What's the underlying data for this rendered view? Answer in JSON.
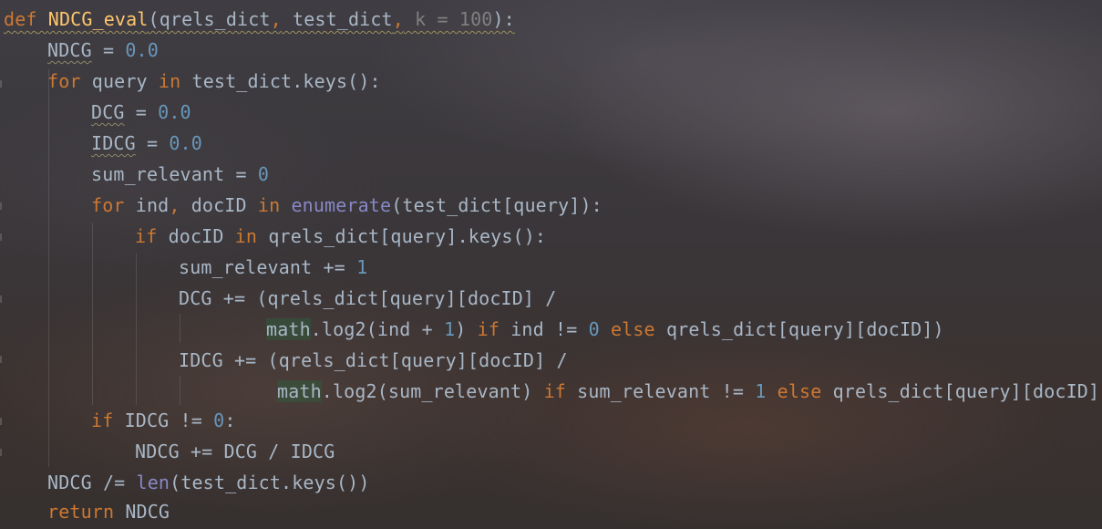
{
  "code": {
    "line1": {
      "kw_def": "def",
      "fn_name": "NDCG_eval",
      "open": "(qrels_dict",
      "comma1": ",",
      "param2": " test_dict",
      "comma2": ",",
      "param3": " k = 100",
      "close": "):"
    },
    "line2": {
      "var": "NDCG",
      "op": " = ",
      "num": "0.0"
    },
    "line3": {
      "kw_for": "for",
      "mid": " query ",
      "kw_in": "in",
      "rest": " test_dict.keys():"
    },
    "line4": {
      "var": "DCG",
      "op": " = ",
      "num": "0.0"
    },
    "line5": {
      "var": "IDCG",
      "op": " = ",
      "num": "0.0"
    },
    "line6": {
      "text": "sum_relevant = ",
      "num": "0"
    },
    "line7": {
      "kw_for": "for",
      "mid": " ind",
      "comma": ",",
      "mid2": " docID ",
      "kw_in": "in",
      "builtin": " enumerate",
      "rest": "(test_dict[query]):"
    },
    "line8": {
      "kw_if": "if",
      "mid": " docID ",
      "kw_in": "in",
      "rest": " qrels_dict[query].keys():"
    },
    "line9": {
      "text": "sum_relevant += ",
      "num": "1"
    },
    "line10": {
      "text": "DCG += (qrels_dict[query][docID] /"
    },
    "line11": {
      "mod": "math",
      "a": ".log2(ind + ",
      "n1": "1",
      "b": ") ",
      "kw_if": "if",
      "c": " ind != ",
      "n2": "0",
      "d": " ",
      "kw_else": "else",
      "e": " qrels_dict[query][docID])"
    },
    "line12": {
      "text": "IDCG += (qrels_dict[query][docID] /"
    },
    "line13": {
      "mod": "math",
      "a": ".log2(sum_relevant) ",
      "kw_if": "if",
      "b": " sum_relevant != ",
      "n1": "1",
      "c": " ",
      "kw_else": "else",
      "d": " qrels_dict[query][docID])"
    },
    "line14": {
      "kw_if": "if",
      "mid": " IDCG != ",
      "num": "0",
      "end": ":"
    },
    "line15": {
      "text": "NDCG += DCG / IDCG"
    },
    "line16": {
      "a": "NDCG /= ",
      "builtin": "len",
      "b": "(test_dict.keys())"
    },
    "line17": {
      "kw_return": "return",
      "rest": " NDCG"
    }
  },
  "colors": {
    "keyword": "#cc7832",
    "function": "#ffc66d",
    "number": "#6897bb",
    "builtin": "#8888c6",
    "text": "#a9b7c6",
    "default_param": "#808080"
  }
}
